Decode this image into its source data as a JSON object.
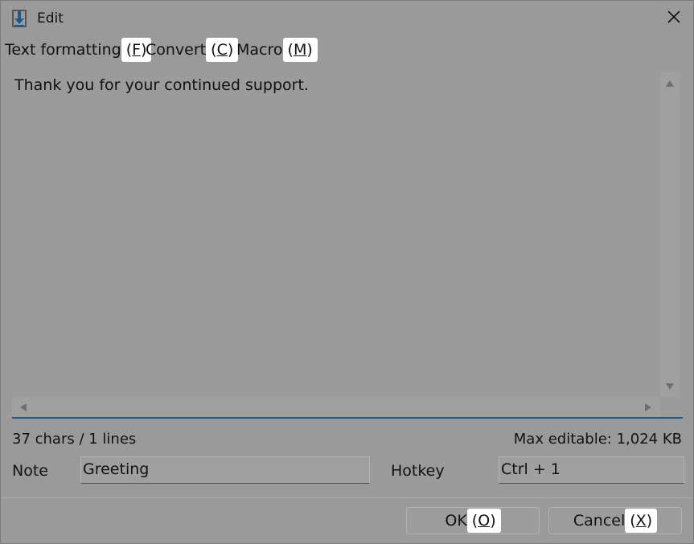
{
  "window": {
    "title": "Edit"
  },
  "menu": [
    {
      "label": "Text formatting",
      "accel": "(F)",
      "key": "F"
    },
    {
      "label": "Convert",
      "accel": "(C)",
      "key": "C"
    },
    {
      "label": "Macro",
      "accel": "(M)",
      "key": "M"
    }
  ],
  "editor": {
    "text": "Thank you for your continued support."
  },
  "status": {
    "counts": "37 chars / 1 lines",
    "max": "Max editable: 1,024 KB"
  },
  "note": {
    "label": "Note",
    "value": "Greeting"
  },
  "hotkey": {
    "label": "Hotkey",
    "value": "Ctrl + 1"
  },
  "buttons": {
    "ok": {
      "label": "OK",
      "accel_open": "(",
      "accel_key": "O",
      "accel_close": ")"
    },
    "cancel": {
      "label": "Cancel",
      "accel_open": "(",
      "accel_key": "X",
      "accel_close": ")"
    }
  },
  "colors": {
    "accent": "#1f5a8c",
    "highlight": "#ffffff"
  },
  "icons": {
    "app": "download-arrow-icon",
    "close": "close-icon"
  }
}
